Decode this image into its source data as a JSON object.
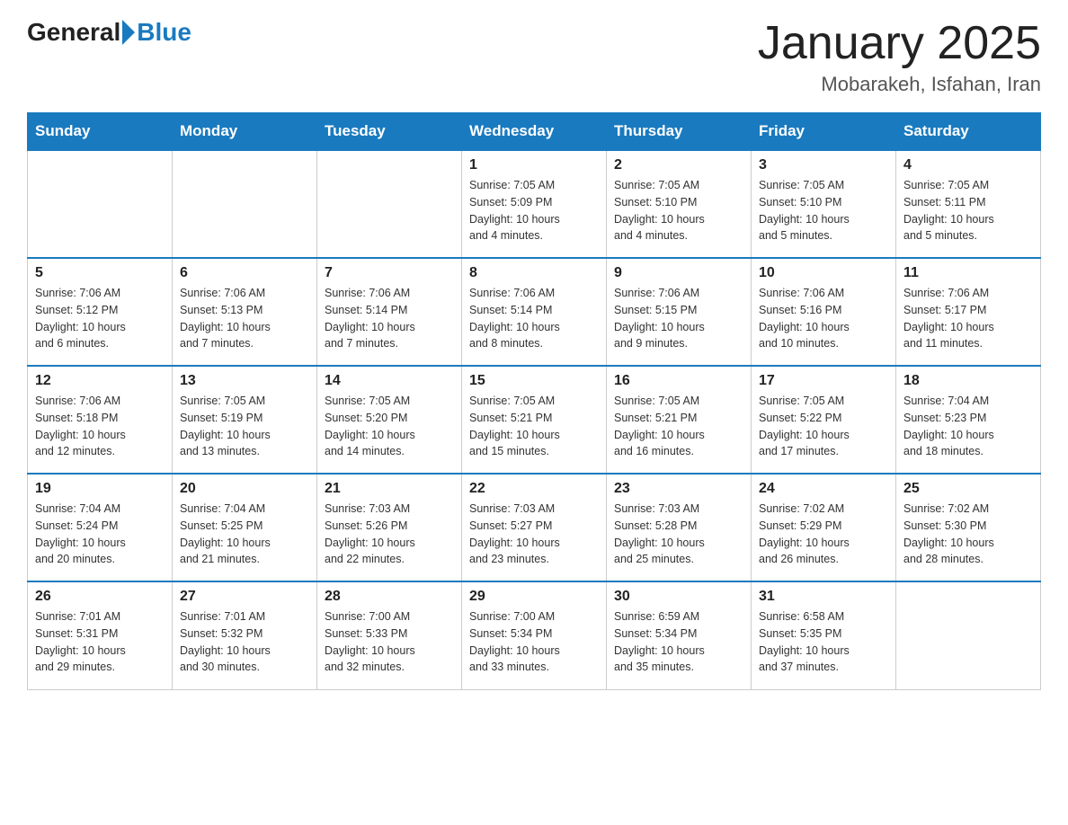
{
  "header": {
    "logo_general": "General",
    "logo_blue": "Blue",
    "title": "January 2025",
    "location": "Mobarakeh, Isfahan, Iran"
  },
  "days_of_week": [
    "Sunday",
    "Monday",
    "Tuesday",
    "Wednesday",
    "Thursday",
    "Friday",
    "Saturday"
  ],
  "weeks": [
    [
      {
        "day": "",
        "info": ""
      },
      {
        "day": "",
        "info": ""
      },
      {
        "day": "",
        "info": ""
      },
      {
        "day": "1",
        "info": "Sunrise: 7:05 AM\nSunset: 5:09 PM\nDaylight: 10 hours\nand 4 minutes."
      },
      {
        "day": "2",
        "info": "Sunrise: 7:05 AM\nSunset: 5:10 PM\nDaylight: 10 hours\nand 4 minutes."
      },
      {
        "day": "3",
        "info": "Sunrise: 7:05 AM\nSunset: 5:10 PM\nDaylight: 10 hours\nand 5 minutes."
      },
      {
        "day": "4",
        "info": "Sunrise: 7:05 AM\nSunset: 5:11 PM\nDaylight: 10 hours\nand 5 minutes."
      }
    ],
    [
      {
        "day": "5",
        "info": "Sunrise: 7:06 AM\nSunset: 5:12 PM\nDaylight: 10 hours\nand 6 minutes."
      },
      {
        "day": "6",
        "info": "Sunrise: 7:06 AM\nSunset: 5:13 PM\nDaylight: 10 hours\nand 7 minutes."
      },
      {
        "day": "7",
        "info": "Sunrise: 7:06 AM\nSunset: 5:14 PM\nDaylight: 10 hours\nand 7 minutes."
      },
      {
        "day": "8",
        "info": "Sunrise: 7:06 AM\nSunset: 5:14 PM\nDaylight: 10 hours\nand 8 minutes."
      },
      {
        "day": "9",
        "info": "Sunrise: 7:06 AM\nSunset: 5:15 PM\nDaylight: 10 hours\nand 9 minutes."
      },
      {
        "day": "10",
        "info": "Sunrise: 7:06 AM\nSunset: 5:16 PM\nDaylight: 10 hours\nand 10 minutes."
      },
      {
        "day": "11",
        "info": "Sunrise: 7:06 AM\nSunset: 5:17 PM\nDaylight: 10 hours\nand 11 minutes."
      }
    ],
    [
      {
        "day": "12",
        "info": "Sunrise: 7:06 AM\nSunset: 5:18 PM\nDaylight: 10 hours\nand 12 minutes."
      },
      {
        "day": "13",
        "info": "Sunrise: 7:05 AM\nSunset: 5:19 PM\nDaylight: 10 hours\nand 13 minutes."
      },
      {
        "day": "14",
        "info": "Sunrise: 7:05 AM\nSunset: 5:20 PM\nDaylight: 10 hours\nand 14 minutes."
      },
      {
        "day": "15",
        "info": "Sunrise: 7:05 AM\nSunset: 5:21 PM\nDaylight: 10 hours\nand 15 minutes."
      },
      {
        "day": "16",
        "info": "Sunrise: 7:05 AM\nSunset: 5:21 PM\nDaylight: 10 hours\nand 16 minutes."
      },
      {
        "day": "17",
        "info": "Sunrise: 7:05 AM\nSunset: 5:22 PM\nDaylight: 10 hours\nand 17 minutes."
      },
      {
        "day": "18",
        "info": "Sunrise: 7:04 AM\nSunset: 5:23 PM\nDaylight: 10 hours\nand 18 minutes."
      }
    ],
    [
      {
        "day": "19",
        "info": "Sunrise: 7:04 AM\nSunset: 5:24 PM\nDaylight: 10 hours\nand 20 minutes."
      },
      {
        "day": "20",
        "info": "Sunrise: 7:04 AM\nSunset: 5:25 PM\nDaylight: 10 hours\nand 21 minutes."
      },
      {
        "day": "21",
        "info": "Sunrise: 7:03 AM\nSunset: 5:26 PM\nDaylight: 10 hours\nand 22 minutes."
      },
      {
        "day": "22",
        "info": "Sunrise: 7:03 AM\nSunset: 5:27 PM\nDaylight: 10 hours\nand 23 minutes."
      },
      {
        "day": "23",
        "info": "Sunrise: 7:03 AM\nSunset: 5:28 PM\nDaylight: 10 hours\nand 25 minutes."
      },
      {
        "day": "24",
        "info": "Sunrise: 7:02 AM\nSunset: 5:29 PM\nDaylight: 10 hours\nand 26 minutes."
      },
      {
        "day": "25",
        "info": "Sunrise: 7:02 AM\nSunset: 5:30 PM\nDaylight: 10 hours\nand 28 minutes."
      }
    ],
    [
      {
        "day": "26",
        "info": "Sunrise: 7:01 AM\nSunset: 5:31 PM\nDaylight: 10 hours\nand 29 minutes."
      },
      {
        "day": "27",
        "info": "Sunrise: 7:01 AM\nSunset: 5:32 PM\nDaylight: 10 hours\nand 30 minutes."
      },
      {
        "day": "28",
        "info": "Sunrise: 7:00 AM\nSunset: 5:33 PM\nDaylight: 10 hours\nand 32 minutes."
      },
      {
        "day": "29",
        "info": "Sunrise: 7:00 AM\nSunset: 5:34 PM\nDaylight: 10 hours\nand 33 minutes."
      },
      {
        "day": "30",
        "info": "Sunrise: 6:59 AM\nSunset: 5:34 PM\nDaylight: 10 hours\nand 35 minutes."
      },
      {
        "day": "31",
        "info": "Sunrise: 6:58 AM\nSunset: 5:35 PM\nDaylight: 10 hours\nand 37 minutes."
      },
      {
        "day": "",
        "info": ""
      }
    ]
  ]
}
